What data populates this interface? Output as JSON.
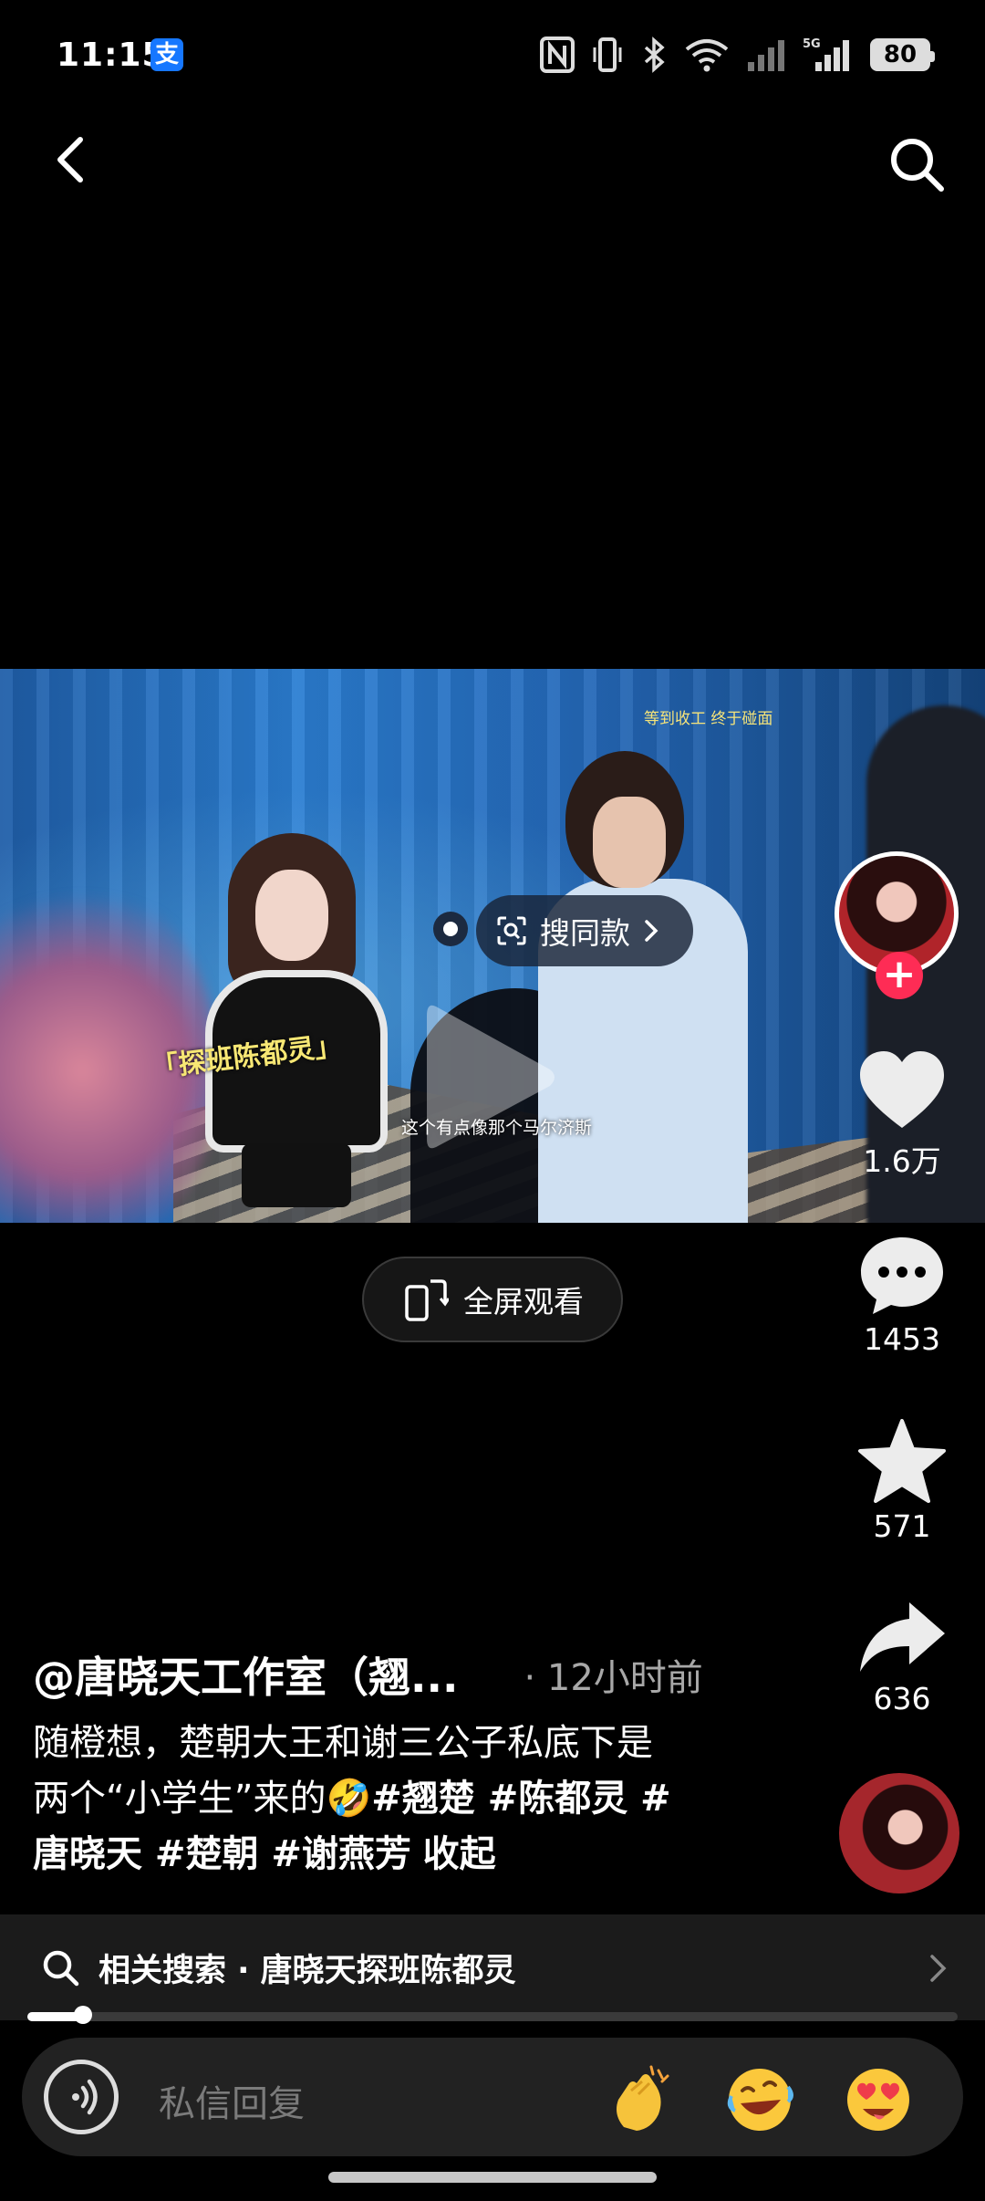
{
  "status_bar": {
    "time": "11:15",
    "alipay_icon": "支",
    "icons": [
      "nfc-icon",
      "vibrate-icon",
      "bluetooth-icon",
      "wifi-icon",
      "signal-icon",
      "signal-5g-icon"
    ],
    "network": "5G",
    "battery": "80"
  },
  "video": {
    "overlay_top": "等到收工 终于碰面",
    "overlay_sub": "这个有点像那个马尔济斯",
    "overlay_tag": "「探班陈都灵」",
    "search_same_label": "搜同款",
    "play_state": "paused"
  },
  "fullscreen": {
    "label": "全屏观看"
  },
  "actions": {
    "likes": "1.6万",
    "comments": "1453",
    "favorites": "571",
    "shares": "636"
  },
  "post": {
    "author": "@唐晓天工作室（翘...",
    "time": "· 12小时前",
    "caption_line1": "随橙想，楚朝大王和谢三公子私底下是",
    "caption_line2_prefix": "两个“小学生”来的🤣",
    "hashtags_line2": "#翘楚 #陈都灵 #",
    "hashtags_line3": "唐晓天 #楚朝 #谢燕芳",
    "collapse": "收起"
  },
  "related_search": {
    "label": "相关搜索 · 唐晓天探班陈都灵"
  },
  "playback": {
    "progress": 0.06
  },
  "reply_bar": {
    "placeholder": "私信回复",
    "emojis": [
      "👏",
      "🤣",
      "😍"
    ]
  },
  "colors": {
    "accent_red": "#fe2c55",
    "overlay_yellow": "#f6e47a",
    "background": "#000000"
  }
}
